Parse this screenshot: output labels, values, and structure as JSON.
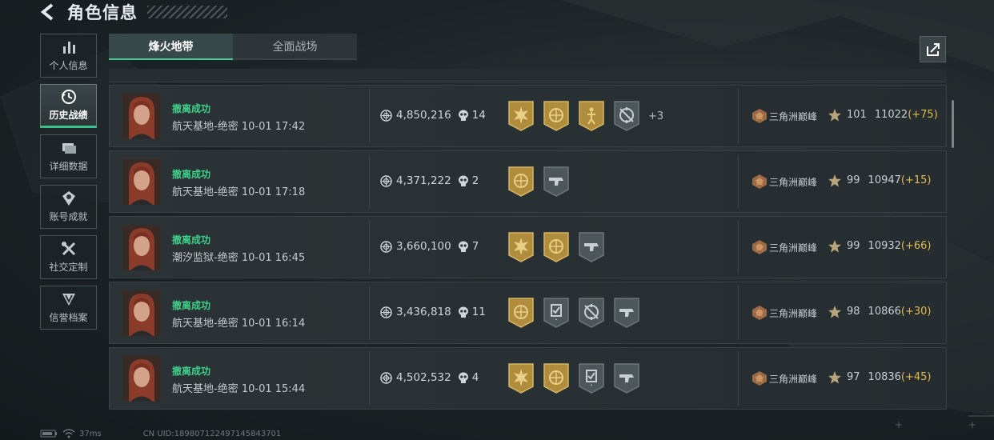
{
  "header": {
    "title": "角色信息"
  },
  "sidebar": {
    "items": [
      {
        "label": "个人信息",
        "icon": "bar-chart-icon",
        "active": false
      },
      {
        "label": "历史战绩",
        "icon": "history-clock-icon",
        "active": true
      },
      {
        "label": "详细数据",
        "icon": "stacked-cards-icon",
        "active": false
      },
      {
        "label": "账号成就",
        "icon": "achievement-medal-icon",
        "active": false
      },
      {
        "label": "社交定制",
        "icon": "wrench-screwdriver-icon",
        "active": false
      },
      {
        "label": "信誉档案",
        "icon": "shield-v-icon",
        "active": false
      }
    ]
  },
  "tabs": [
    {
      "label": "烽火地带",
      "active": true
    },
    {
      "label": "全面战场",
      "active": false
    }
  ],
  "colors": {
    "accent": "#3fcf95",
    "success_text": "#3fd089",
    "score_delta": "#e2bb4c",
    "gold_badge": "#b08d3c",
    "grey_badge": "#4d5659"
  },
  "matches": [
    {
      "status": "撤离成功",
      "map": "航天基地-绝密",
      "time": "10-01 17:42",
      "money": "4,850,216",
      "kills": "14",
      "badges": [
        "gold-sun",
        "gold-circle",
        "gold-figure",
        "grey-crosshair"
      ],
      "more": "+3",
      "rank": "三角洲巅峰",
      "level": "101",
      "score": "11022",
      "delta": "(+75)"
    },
    {
      "status": "撤离成功",
      "map": "航天基地-绝密",
      "time": "10-01 17:18",
      "money": "4,371,222",
      "kills": "2",
      "badges": [
        "gold-circle",
        "grey-gun"
      ],
      "more": "",
      "rank": "三角洲巅峰",
      "level": "99",
      "score": "10947",
      "delta": "(+15)"
    },
    {
      "status": "撤离成功",
      "map": "潮汐监狱-绝密",
      "time": "10-01 16:45",
      "money": "3,660,100",
      "kills": "7",
      "badges": [
        "gold-sun",
        "gold-circle",
        "grey-gun"
      ],
      "more": "",
      "rank": "三角洲巅峰",
      "level": "99",
      "score": "10932",
      "delta": "(+66)"
    },
    {
      "status": "撤离成功",
      "map": "航天基地-绝密",
      "time": "10-01 16:14",
      "money": "3,436,818",
      "kills": "11",
      "badges": [
        "gold-circle",
        "grey-check",
        "grey-crosshair",
        "grey-gun"
      ],
      "more": "",
      "rank": "三角洲巅峰",
      "level": "98",
      "score": "10866",
      "delta": "(+30)"
    },
    {
      "status": "撤离成功",
      "map": "航天基地-绝密",
      "time": "10-01 15:44",
      "money": "4,502,532",
      "kills": "4",
      "badges": [
        "gold-sun",
        "gold-circle",
        "grey-check",
        "grey-gun"
      ],
      "more": "",
      "rank": "三角洲巅峰",
      "level": "97",
      "score": "10836",
      "delta": "(+45)"
    }
  ],
  "status_bar": {
    "ping": "37ms",
    "uid": "CN UID:18980712249714584370​1"
  }
}
